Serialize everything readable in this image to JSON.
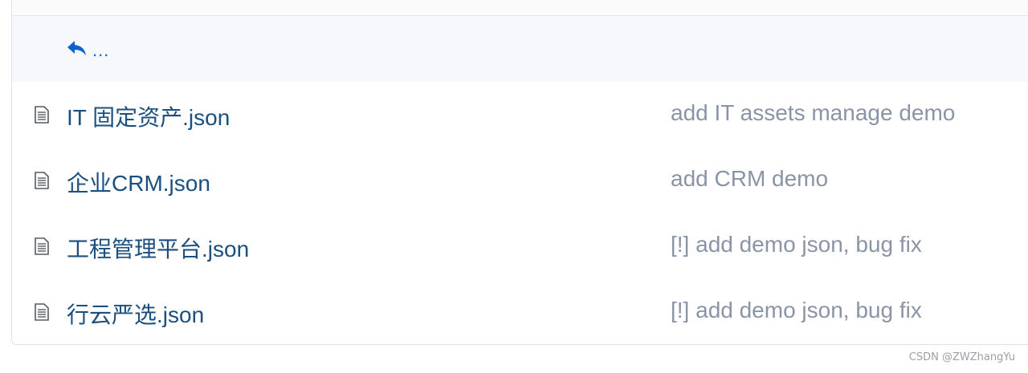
{
  "parent_link": {
    "label": "..."
  },
  "files": [
    {
      "name": "IT 固定资产.json",
      "commit": "add IT assets manage demo"
    },
    {
      "name": "企业CRM.json",
      "commit": "add CRM demo"
    },
    {
      "name": "工程管理平台.json",
      "commit": "[!] add demo json, bug fix"
    },
    {
      "name": "行云严选.json",
      "commit": "[!] add demo json, bug fix"
    }
  ],
  "icons": {
    "back": "reply-arrow-icon",
    "file": "file-text-icon"
  },
  "colors": {
    "link": "#1a4f7f",
    "accent": "#0b63ce",
    "muted": "#8a94a6",
    "row_highlight": "#f6f8fc"
  },
  "watermark": "CSDN @ZWZhangYu"
}
